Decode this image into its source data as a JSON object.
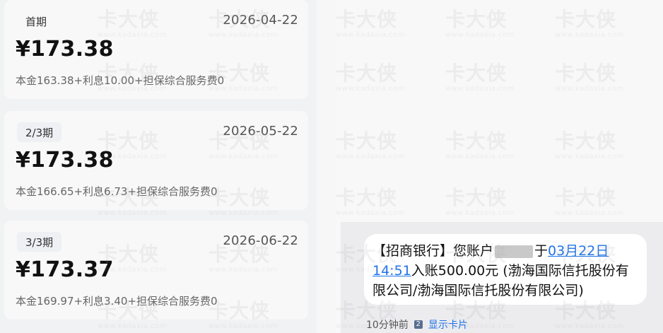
{
  "installments": [
    {
      "period": "首期",
      "date": "2026-04-22",
      "amount": "¥173.38",
      "detail": "本金163.38+利息10.00+担保综合服务费0"
    },
    {
      "period": "2/3期",
      "date": "2026-05-22",
      "amount": "¥173.38",
      "detail": "本金166.65+利息6.73+担保综合服务费0"
    },
    {
      "period": "3/3期",
      "date": "2026-06-22",
      "amount": "¥173.37",
      "detail": "本金169.97+利息3.40+担保综合服务费0"
    }
  ],
  "sms": {
    "prefix": "【招商银行】您账户",
    "masked_label": "",
    "middle": "于",
    "date_link": "03月22日",
    "time_link": "14:51",
    "suffix": "入账500.00元 (渤海国际信托股份有限公司/渤海国际信托股份有限公司)",
    "time_ago": "10分钟前",
    "show_card": "显示卡片"
  },
  "watermark": {
    "brand": "卡大侠",
    "url": "www.kadaxia.com"
  }
}
